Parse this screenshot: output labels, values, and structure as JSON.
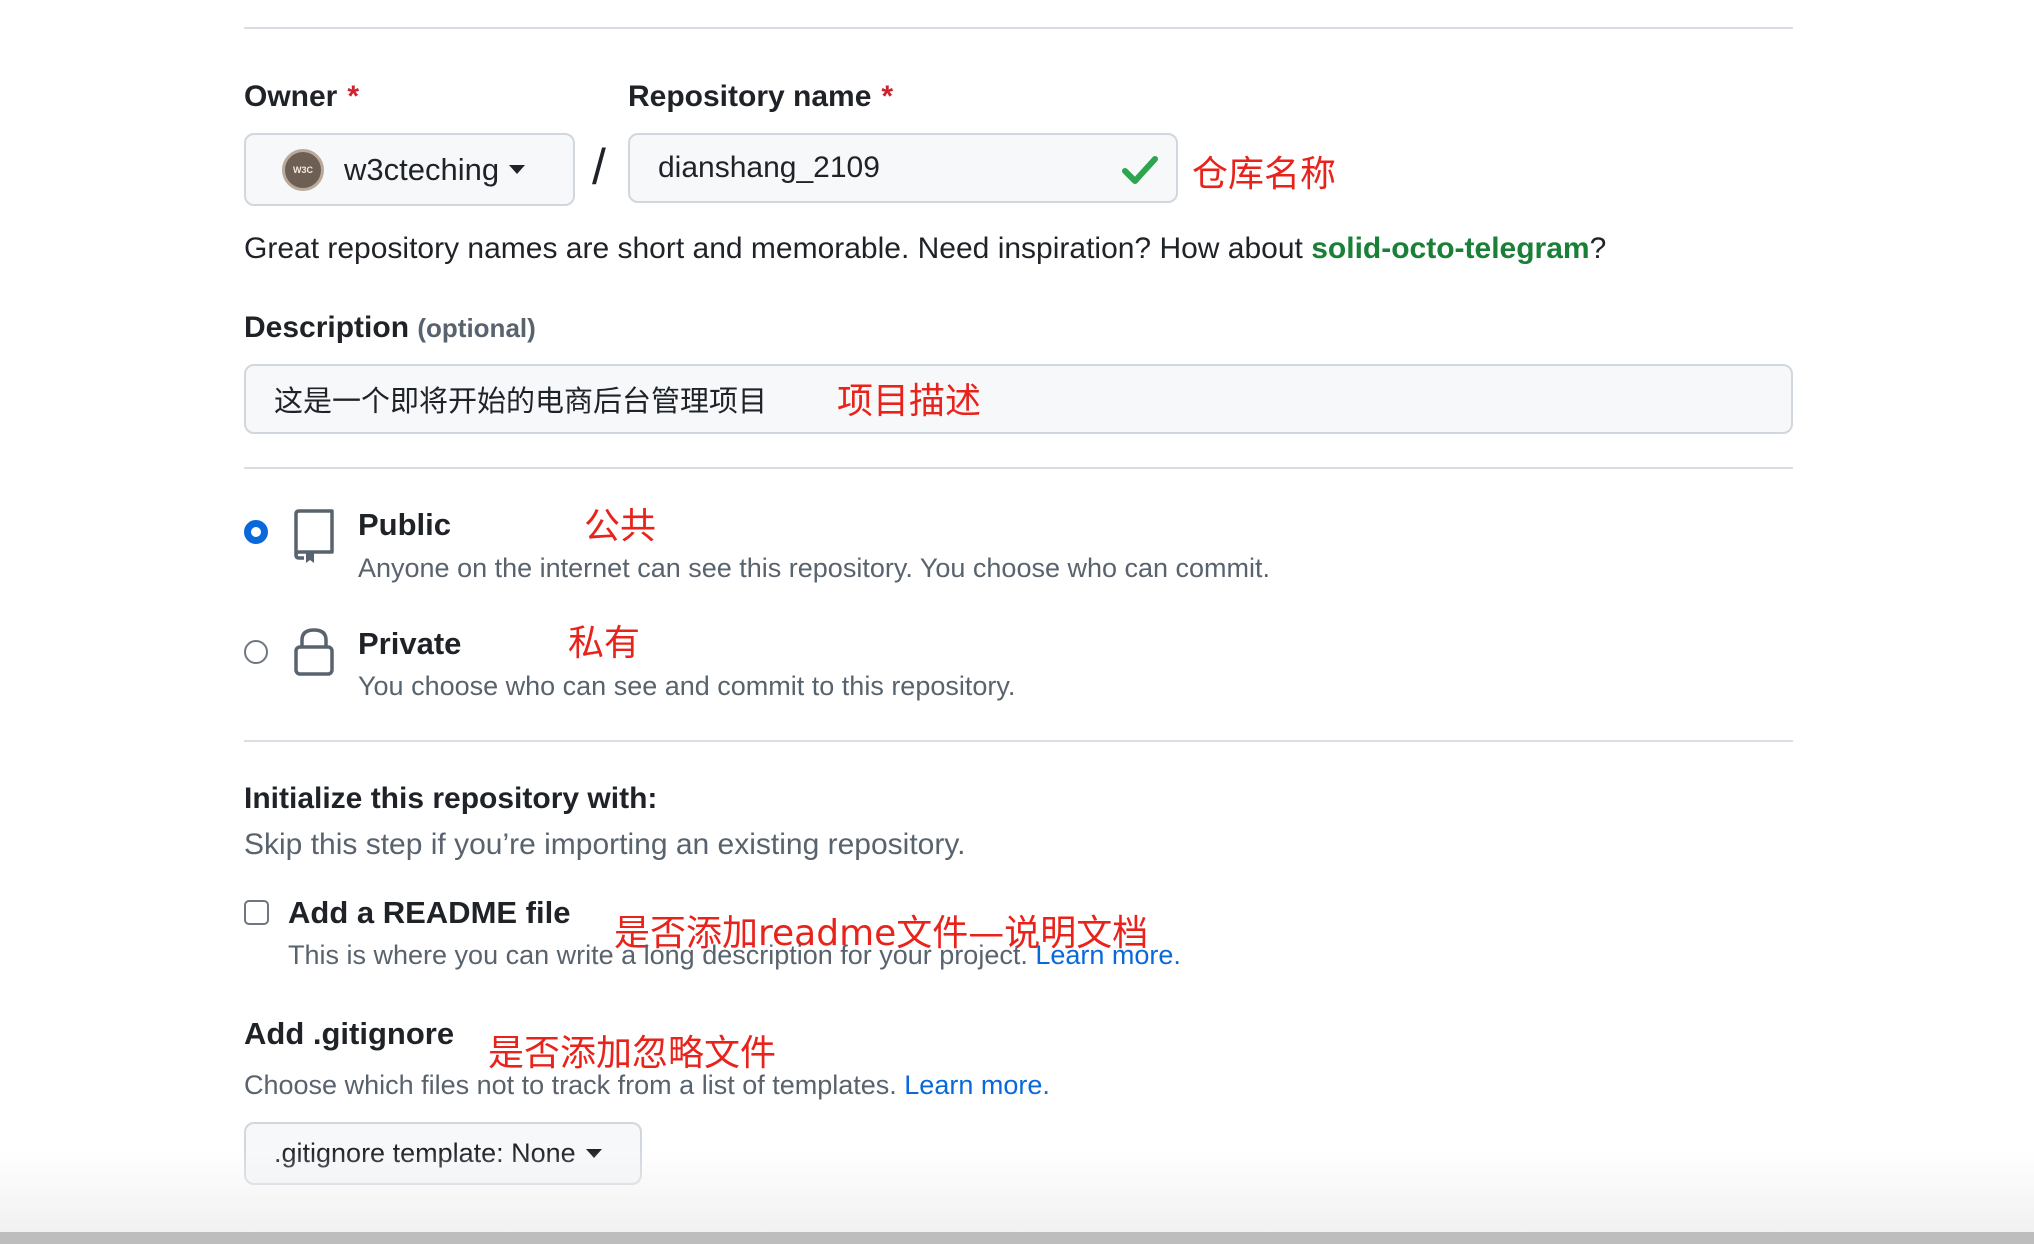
{
  "owner": {
    "label": "Owner",
    "required_mark": "*",
    "value": "w3cteching",
    "avatar_text": "W3C"
  },
  "separator": "/",
  "repo_name": {
    "label": "Repository name",
    "required_mark": "*",
    "value": "dianshang_2109",
    "annotation": "仓库名称"
  },
  "suggestion": {
    "prefix": "Great repository names are short and memorable. Need inspiration? How about ",
    "name": "solid-octo-telegram",
    "suffix": "?"
  },
  "description": {
    "label": "Description",
    "optional": "(optional)",
    "value": "这是一个即将开始的电商后台管理项目",
    "annotation": "项目描述"
  },
  "visibility": {
    "public": {
      "title": "Public",
      "desc": "Anyone on the internet can see this repository. You choose who can commit.",
      "annotation": "公共",
      "selected": true
    },
    "private": {
      "title": "Private",
      "desc": "You choose who can see and commit to this repository.",
      "annotation": "私有",
      "selected": false
    }
  },
  "init": {
    "title": "Initialize this repository with:",
    "subtitle": "Skip this step if you’re importing an existing repository.",
    "readme": {
      "label": "Add a README file",
      "desc": "This is where you can write a long description for your project. ",
      "link": "Learn more.",
      "annotation": "是否添加readme文件—说明文档",
      "checked": false
    }
  },
  "gitignore": {
    "title": "Add .gitignore",
    "annotation": "是否添加忽略文件",
    "desc": "Choose which files not to track from a list of templates. ",
    "link": "Learn more.",
    "select_label": ".gitignore template: None"
  },
  "colors": {
    "accent": "#0969da",
    "success": "#1a7f37",
    "annotation": "#e8231b",
    "danger": "#cf222e"
  }
}
